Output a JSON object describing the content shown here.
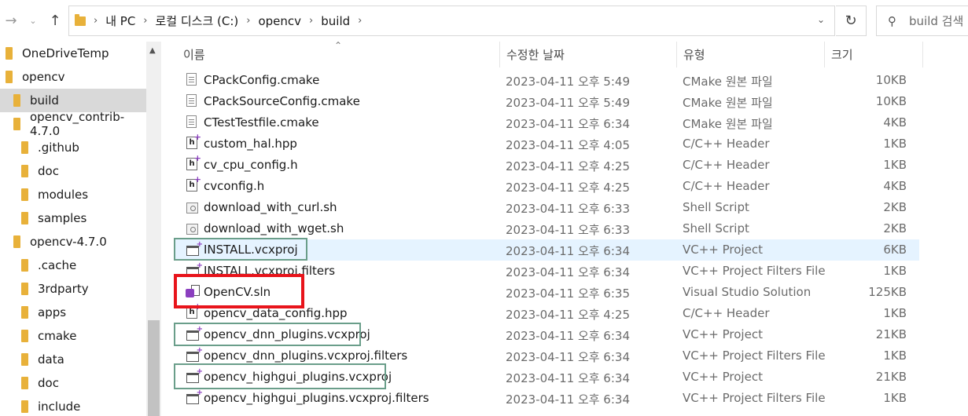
{
  "address_bar": {
    "breadcrumbs": [
      "내 PC",
      "로컬 디스크 (C:)",
      "opencv",
      "build"
    ],
    "search_placeholder": "build 검색"
  },
  "sidebar": {
    "items": [
      {
        "label": "OneDriveTemp",
        "indent": 0,
        "selected": false
      },
      {
        "label": "opencv",
        "indent": 0,
        "selected": false
      },
      {
        "label": "build",
        "indent": 1,
        "selected": true
      },
      {
        "label": "opencv_contrib-4.7.0",
        "indent": 1,
        "selected": false
      },
      {
        "label": ".github",
        "indent": 2,
        "selected": false
      },
      {
        "label": "doc",
        "indent": 2,
        "selected": false
      },
      {
        "label": "modules",
        "indent": 2,
        "selected": false
      },
      {
        "label": "samples",
        "indent": 2,
        "selected": false
      },
      {
        "label": "opencv-4.7.0",
        "indent": 1,
        "selected": false
      },
      {
        "label": ".cache",
        "indent": 2,
        "selected": false
      },
      {
        "label": "3rdparty",
        "indent": 2,
        "selected": false
      },
      {
        "label": "apps",
        "indent": 2,
        "selected": false
      },
      {
        "label": "cmake",
        "indent": 2,
        "selected": false
      },
      {
        "label": "data",
        "indent": 2,
        "selected": false
      },
      {
        "label": "doc",
        "indent": 2,
        "selected": false
      },
      {
        "label": "include",
        "indent": 2,
        "selected": false
      }
    ]
  },
  "columns": {
    "name": "이름",
    "date": "수정한 날짜",
    "type": "유형",
    "size": "크기"
  },
  "files": [
    {
      "name": "CPackConfig.cmake",
      "date": "2023-04-11 오후 5:49",
      "type": "CMake 원본 파일",
      "size": "10KB",
      "icon": "document-icon"
    },
    {
      "name": "CPackSourceConfig.cmake",
      "date": "2023-04-11 오후 5:49",
      "type": "CMake 원본 파일",
      "size": "10KB",
      "icon": "document-icon"
    },
    {
      "name": "CTestTestfile.cmake",
      "date": "2023-04-11 오후 6:34",
      "type": "CMake 원본 파일",
      "size": "4KB",
      "icon": "document-icon"
    },
    {
      "name": "custom_hal.hpp",
      "date": "2023-04-11 오후 4:05",
      "type": "C/C++ Header",
      "size": "1KB",
      "icon": "header-file-icon"
    },
    {
      "name": "cv_cpu_config.h",
      "date": "2023-04-11 오후 4:25",
      "type": "C/C++ Header",
      "size": "1KB",
      "icon": "header-file-icon"
    },
    {
      "name": "cvconfig.h",
      "date": "2023-04-11 오후 4:25",
      "type": "C/C++ Header",
      "size": "4KB",
      "icon": "header-file-icon"
    },
    {
      "name": "download_with_curl.sh",
      "date": "2023-04-11 오후 6:33",
      "type": "Shell Script",
      "size": "2KB",
      "icon": "shell-script-icon"
    },
    {
      "name": "download_with_wget.sh",
      "date": "2023-04-11 오후 6:33",
      "type": "Shell Script",
      "size": "2KB",
      "icon": "shell-script-icon"
    },
    {
      "name": "INSTALL.vcxproj",
      "date": "2023-04-11 오후 6:34",
      "type": "VC++ Project",
      "size": "6KB",
      "icon": "vcxproj-icon"
    },
    {
      "name": "INSTALL.vcxproj.filters",
      "date": "2023-04-11 오후 6:34",
      "type": "VC++ Project Filters File",
      "size": "1KB",
      "icon": "vcxproj-filters-icon"
    },
    {
      "name": "OpenCV.sln",
      "date": "2023-04-11 오후 6:35",
      "type": "Visual Studio Solution",
      "size": "125KB",
      "icon": "vs-solution-icon"
    },
    {
      "name": "opencv_data_config.hpp",
      "date": "2023-04-11 오후 4:25",
      "type": "C/C++ Header",
      "size": "1KB",
      "icon": "header-file-icon"
    },
    {
      "name": "opencv_dnn_plugins.vcxproj",
      "date": "2023-04-11 오후 6:34",
      "type": "VC++ Project",
      "size": "21KB",
      "icon": "vcxproj-icon"
    },
    {
      "name": "opencv_dnn_plugins.vcxproj.filters",
      "date": "2023-04-11 오후 6:34",
      "type": "VC++ Project Filters File",
      "size": "1KB",
      "icon": "vcxproj-filters-icon"
    },
    {
      "name": "opencv_highgui_plugins.vcxproj",
      "date": "2023-04-11 오후 6:34",
      "type": "VC++ Project",
      "size": "21KB",
      "icon": "vcxproj-icon"
    },
    {
      "name": "opencv_highgui_plugins.vcxproj.filters",
      "date": "2023-04-11 오후 6:34",
      "type": "VC++ Project Filters File",
      "size": "1KB",
      "icon": "vcxproj-filters-icon"
    }
  ],
  "colors": {
    "folder": "#e8b13a",
    "selected_row": "#d9d9d9",
    "hover_row": "#e5f3ff",
    "annotation_green": "#6a9e8a",
    "annotation_red": "#e8141b"
  }
}
